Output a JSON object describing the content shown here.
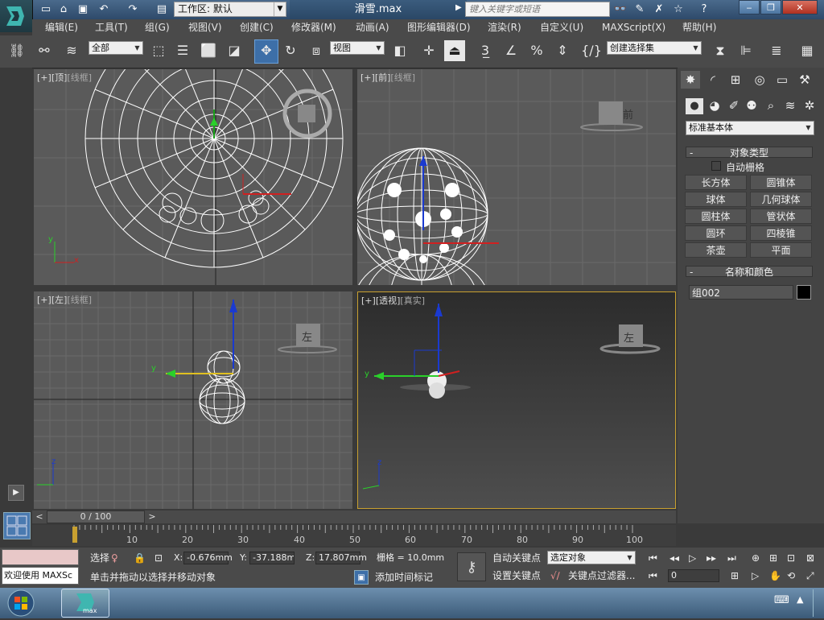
{
  "title": {
    "workspace_label": "工作区: 默认",
    "file_name": "滑雪.max",
    "search_placeholder": "键入关键字或短语"
  },
  "menu": [
    "编辑(E)",
    "工具(T)",
    "组(G)",
    "视图(V)",
    "创建(C)",
    "修改器(M)",
    "动画(A)",
    "图形编辑器(D)",
    "渲染(R)",
    "自定义(U)",
    "MAXScript(X)",
    "帮助(H)"
  ],
  "toolbar": {
    "filter_value": "全部",
    "ref_coord_value": "视图",
    "named_selection_placeholder": "创建选择集"
  },
  "viewports": {
    "top": {
      "plus": "[+]",
      "name": "[顶]",
      "shade": "[线框]",
      "cube_label": ""
    },
    "front": {
      "plus": "[+]",
      "name": "[前]",
      "shade": "[线框]",
      "cube_label": "前"
    },
    "left": {
      "plus": "[+]",
      "name": "[左]",
      "shade": "[线框]",
      "cube_label": "左"
    },
    "persp": {
      "plus": "[+]",
      "name": "[透视]",
      "shade": "[真实]",
      "cube_label": "左"
    }
  },
  "axes": {
    "x": "x",
    "y": "y",
    "z": "z"
  },
  "command_panel": {
    "category_value": "标准基本体",
    "object_type_title": "对象类型",
    "auto_grid_label": "自动栅格",
    "buttons": [
      "长方体",
      "圆锥体",
      "球体",
      "几何球体",
      "圆柱体",
      "管状体",
      "圆环",
      "四棱锥",
      "茶壶",
      "平面"
    ],
    "name_color_title": "名称和颜色",
    "object_name": "组002",
    "object_color": "#000000"
  },
  "timeline": {
    "frame_readout": "0 / 100",
    "ticks": [
      "10",
      "20",
      "30",
      "40",
      "50",
      "60",
      "70",
      "80",
      "90",
      "100"
    ]
  },
  "status": {
    "maxscript_label": "欢迎使用 MAXSc",
    "select_label": "选择",
    "x_label": "X:",
    "x_value": "-0.676mm",
    "y_label": "Y:",
    "y_value": "-37.188mm",
    "z_label": "Z:",
    "z_value": "17.807mm",
    "grid_label": "栅格 = 10.0mm",
    "prompt": "单击并拖动以选择并移动对象",
    "add_time_tag": "添加时间标记",
    "auto_key": "自动关键点",
    "set_key": "设置关键点",
    "key_mode_value": "选定对象",
    "key_filters": "关键点过滤器...",
    "current_frame": "0"
  },
  "taskbar": {
    "app_label": "max"
  }
}
